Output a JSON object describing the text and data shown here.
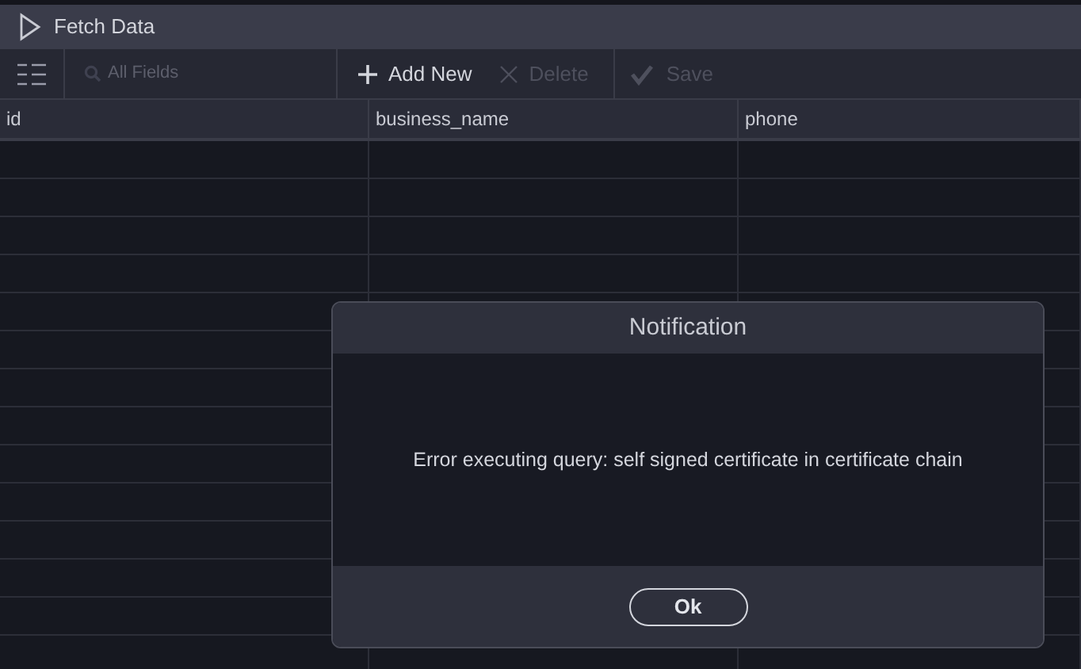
{
  "title_bar": {
    "label": "Fetch Data"
  },
  "toolbar": {
    "search": {
      "placeholder": "All Fields"
    },
    "buttons": [
      {
        "label": "Add New",
        "kind": "add",
        "disabled": false
      },
      {
        "label": "Delete",
        "kind": "delete",
        "disabled": true
      },
      {
        "label": "Save",
        "kind": "save",
        "disabled": true
      }
    ]
  },
  "table": {
    "columns": [
      "id",
      "business_name",
      "phone"
    ]
  },
  "dialog": {
    "title": "Notification",
    "message": "Error executing query: self signed certificate in certificate chain",
    "button": "Ok"
  }
}
